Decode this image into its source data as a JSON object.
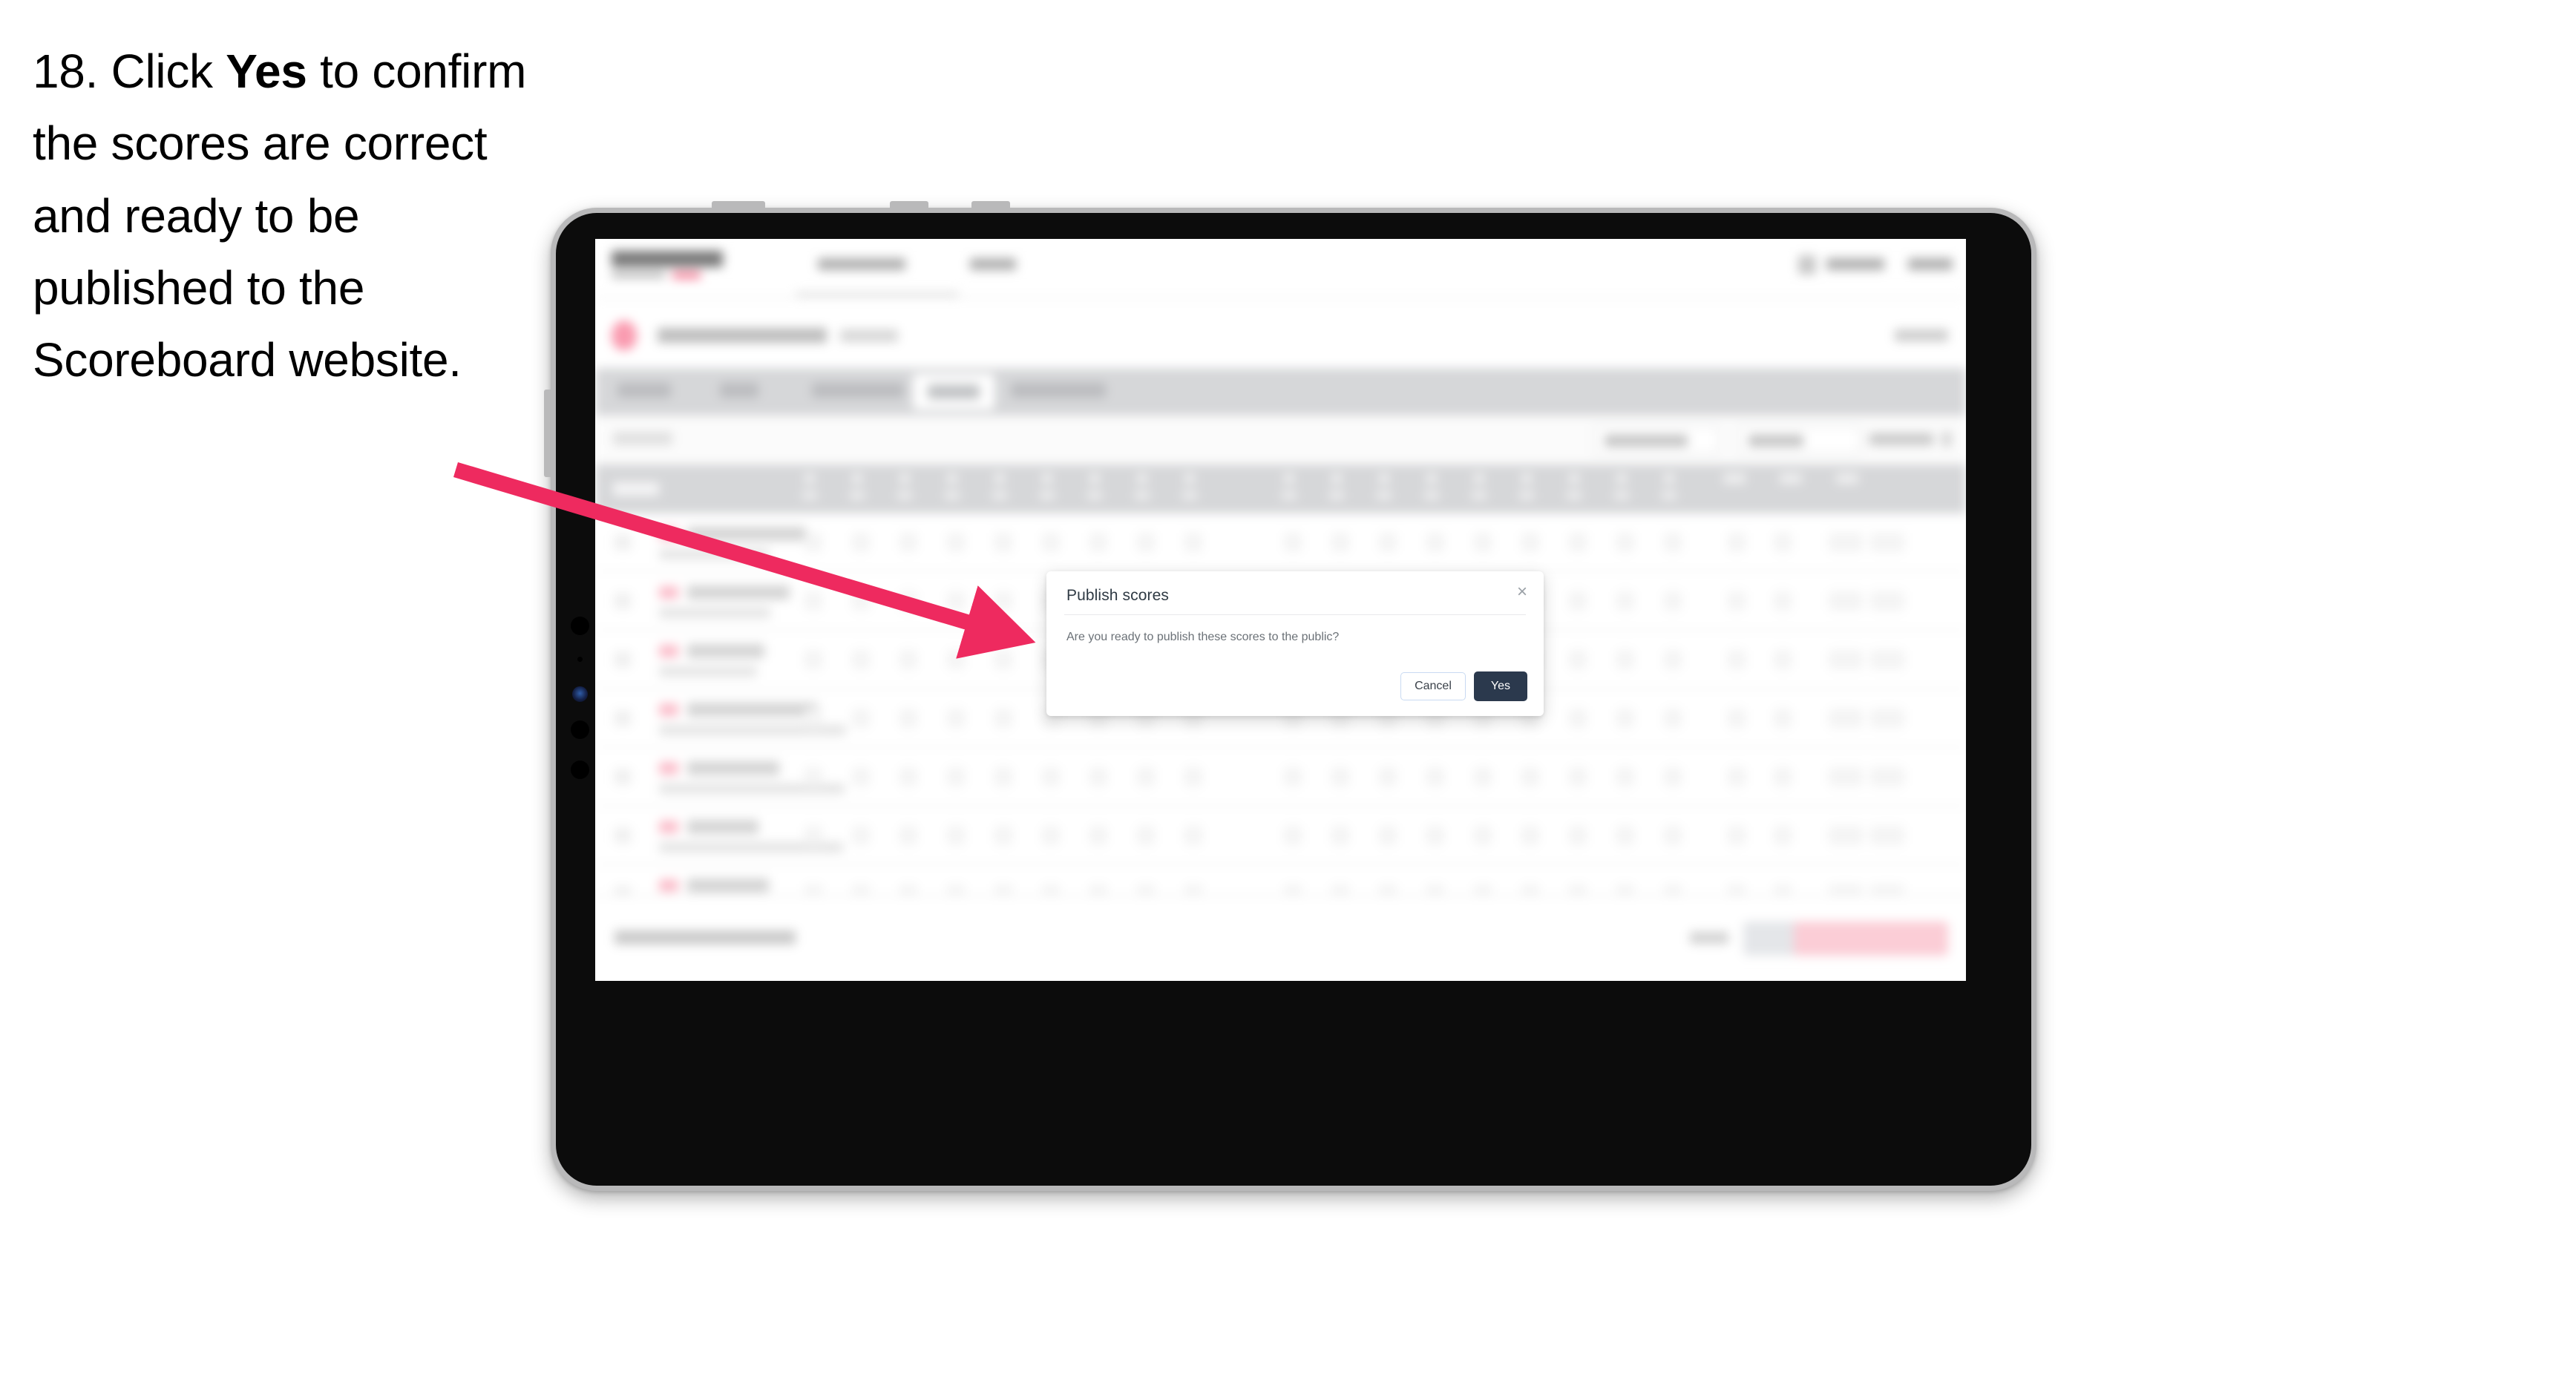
{
  "instruction": {
    "number": "18.",
    "text_before": "Click ",
    "emphasis": "Yes",
    "text_after": " to confirm the scores are correct and ready to be published to the Scoreboard website."
  },
  "modal": {
    "title": "Publish scores",
    "body": "Are you ready to publish these scores to the public?",
    "close_icon": "close-icon",
    "close_glyph": "×",
    "cancel_label": "Cancel",
    "yes_label": "Yes"
  },
  "colors": {
    "arrow": "#ee2a5f",
    "yes_button_bg": "#2b394d",
    "cancel_border": "#c9daf2",
    "device_bezel": "#b9b9ba",
    "device_body": "#0c0c0c",
    "tabbar_bg": "#d6d7d9",
    "accent_pink": "#f5496f"
  },
  "device": {
    "name": "tablet-mockup",
    "orientation": "landscape"
  },
  "background_app": {
    "note": "Scoreboard results application, visually blurred behind the modal",
    "table_rows": 7,
    "tab_count": 5,
    "active_tab_index": 3
  }
}
